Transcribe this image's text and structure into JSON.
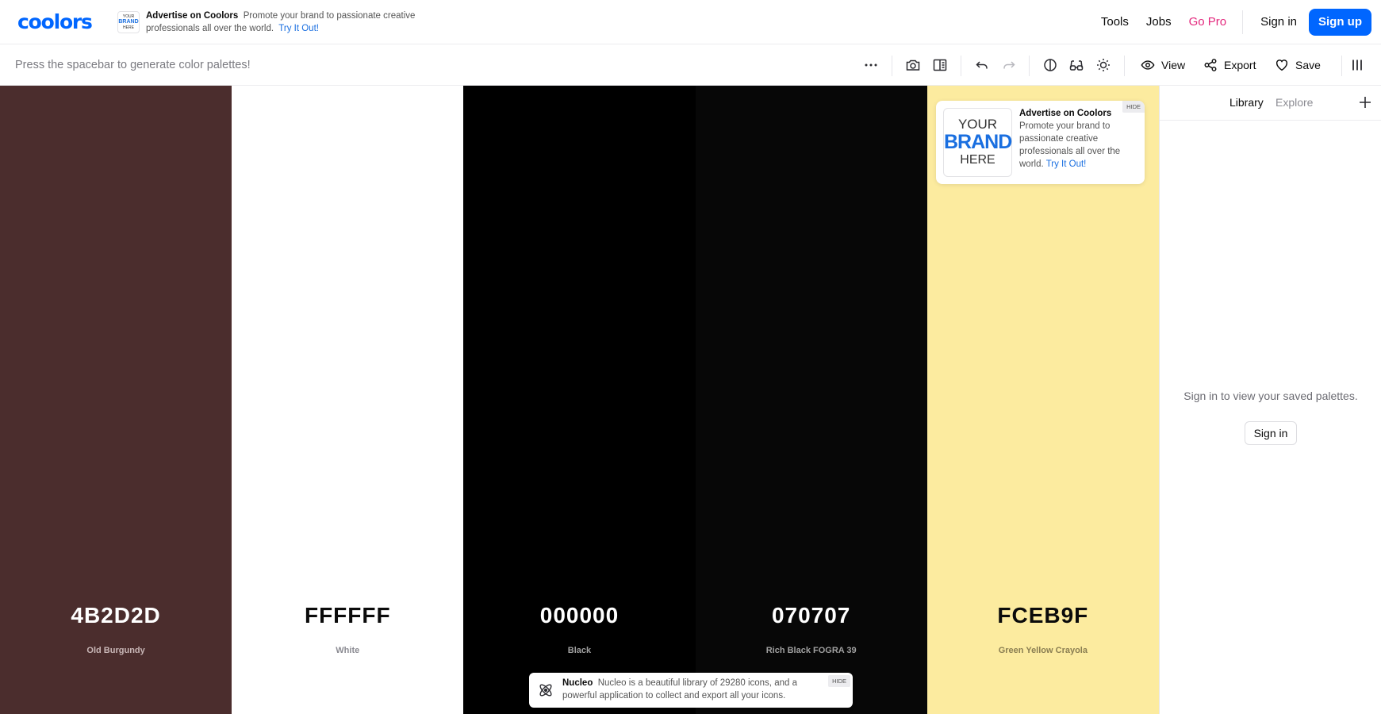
{
  "brand": {
    "logo_text": "coolors"
  },
  "top_ad": {
    "thumb_line1": "YOUR",
    "thumb_line2": "BRAND",
    "thumb_line3": "HERE",
    "title": "Advertise on Coolors",
    "body": "Promote your brand to passionate creative professionals all over the world.",
    "link": "Try It Out!"
  },
  "nav": {
    "tools": "Tools",
    "jobs": "Jobs",
    "gopro": "Go Pro",
    "signin": "Sign in",
    "signup": "Sign up",
    "gopro_color": "#e3287d",
    "accent": "#0066ff"
  },
  "toolbar": {
    "hint": "Press the spacebar to generate color palettes!",
    "view_label": "View",
    "export_label": "Export",
    "save_label": "Save",
    "icons": [
      "more-icon",
      "camera-icon",
      "book-icon",
      "undo-icon",
      "redo-icon",
      "contrast-icon",
      "glasses-icon",
      "sun-icon",
      "eye-icon",
      "share-icon",
      "heart-icon",
      "columns-icon"
    ]
  },
  "palette": [
    {
      "hex": "4B2D2D",
      "name": "Old Burgundy",
      "bg": "#4b2d2d",
      "text_color": "#ffffff",
      "name_color": "#c9b7b7"
    },
    {
      "hex": "FFFFFF",
      "name": "White",
      "bg": "#ffffff",
      "text_color": "#0b0b0b",
      "name_color": "#8b8b92"
    },
    {
      "hex": "000000",
      "name": "Black",
      "bg": "#000000",
      "text_color": "#ffffff",
      "name_color": "#a0a0a0"
    },
    {
      "hex": "070707",
      "name": "Rich Black FOGRA 39",
      "bg": "#070707",
      "text_color": "#ffffff",
      "name_color": "#a0a0a0"
    },
    {
      "hex": "FCEB9F",
      "name": "Green Yellow Crayola",
      "bg": "#fceb9f",
      "text_color": "#0b0b0b",
      "name_color": "#8a7e52"
    }
  ],
  "ad_card": {
    "brand_line1": "YOUR",
    "brand_line2": "BRAND",
    "brand_line3": "HERE",
    "title": "Advertise on Coolors",
    "body": "Promote your brand to passionate creative professionals all over the world.",
    "link": "Try It Out!",
    "hide": "HIDE"
  },
  "toast": {
    "title": "Nucleo",
    "body": "Nucleo is a beautiful library of 29280 icons, and a powerful application to collect and export all your icons.",
    "hide": "HIDE"
  },
  "library": {
    "tab_library": "Library",
    "tab_explore": "Explore",
    "empty_text": "Sign in to view your saved palettes.",
    "signin": "Sign in"
  }
}
